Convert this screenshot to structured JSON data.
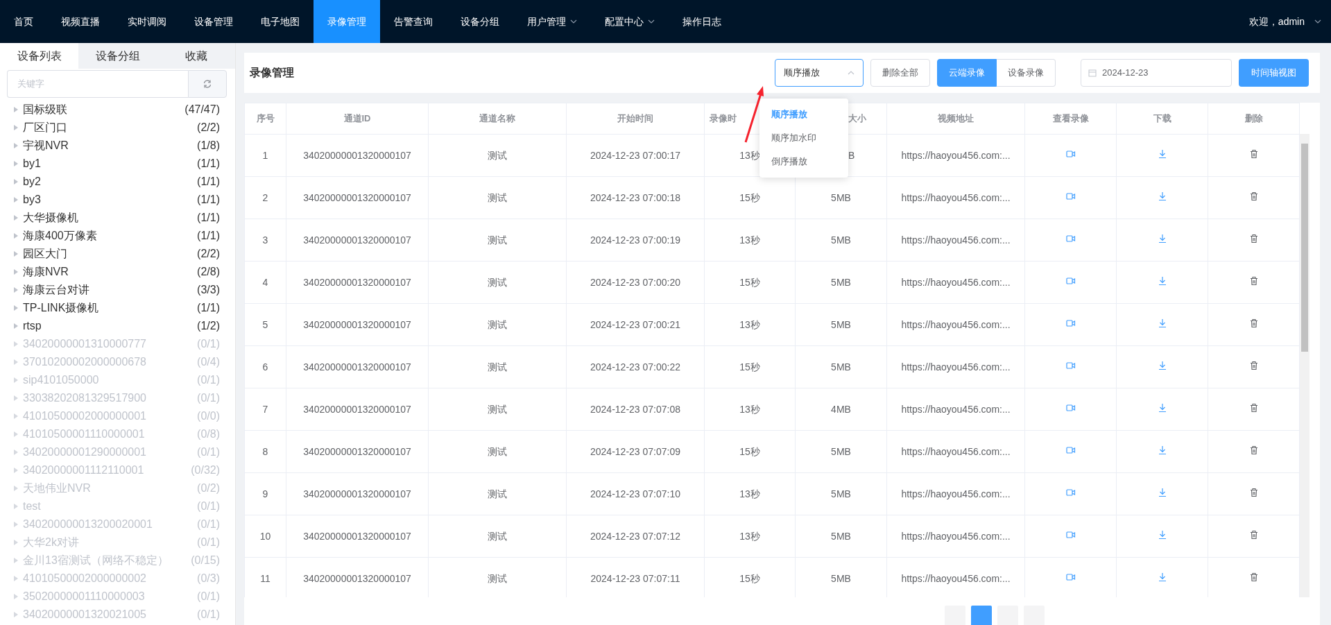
{
  "nav": {
    "items": [
      {
        "label": "首页",
        "selected": false,
        "has_menu": false
      },
      {
        "label": "视频直播",
        "selected": false,
        "has_menu": false
      },
      {
        "label": "实时调阅",
        "selected": false,
        "has_menu": false
      },
      {
        "label": "设备管理",
        "selected": false,
        "has_menu": false
      },
      {
        "label": "电子地图",
        "selected": false,
        "has_menu": false
      },
      {
        "label": "录像管理",
        "selected": true,
        "has_menu": false
      },
      {
        "label": "告警查询",
        "selected": false,
        "has_menu": false
      },
      {
        "label": "设备分组",
        "selected": false,
        "has_menu": false
      },
      {
        "label": "用户管理",
        "selected": false,
        "has_menu": true
      },
      {
        "label": "配置中心",
        "selected": false,
        "has_menu": true
      },
      {
        "label": "操作日志",
        "selected": false,
        "has_menu": false
      }
    ],
    "user": "欢迎，admin"
  },
  "sidebar": {
    "tabs": [
      {
        "label": "设备列表",
        "selected": true
      },
      {
        "label": "设备分组",
        "selected": false
      },
      {
        "label": "收藏",
        "selected": false
      }
    ],
    "search": {
      "placeholder": "关键字"
    },
    "devices": [
      {
        "name": "国标级联",
        "count": "(47/47)",
        "online": true
      },
      {
        "name": "厂区门口",
        "count": "(2/2)",
        "online": true
      },
      {
        "name": "宇视NVR",
        "count": "(1/8)",
        "online": true
      },
      {
        "name": "by1",
        "count": "(1/1)",
        "online": true
      },
      {
        "name": "by2",
        "count": "(1/1)",
        "online": true
      },
      {
        "name": "by3",
        "count": "(1/1)",
        "online": true
      },
      {
        "name": "大华摄像机",
        "count": "(1/1)",
        "online": true
      },
      {
        "name": "海康400万像素",
        "count": "(1/1)",
        "online": true
      },
      {
        "name": "园区大门",
        "count": "(2/2)",
        "online": true
      },
      {
        "name": "海康NVR",
        "count": "(2/8)",
        "online": true
      },
      {
        "name": "海康云台对讲",
        "count": "(3/3)",
        "online": true
      },
      {
        "name": "TP-LINK摄像机",
        "count": "(1/1)",
        "online": true
      },
      {
        "name": "rtsp",
        "count": "(1/2)",
        "online": true
      },
      {
        "name": "34020000001310000777",
        "count": "(0/1)",
        "online": false
      },
      {
        "name": "37010200002000000678",
        "count": "(0/4)",
        "online": false
      },
      {
        "name": "sip4101050000",
        "count": "(0/1)",
        "online": false
      },
      {
        "name": "33038202081329517900",
        "count": "(0/1)",
        "online": false
      },
      {
        "name": "41010500002000000001",
        "count": "(0/0)",
        "online": false
      },
      {
        "name": "41010500001110000001",
        "count": "(0/8)",
        "online": false
      },
      {
        "name": "34020000001290000001",
        "count": "(0/1)",
        "online": false
      },
      {
        "name": "34020000001112110001",
        "count": "(0/32)",
        "online": false
      },
      {
        "name": "天地伟业NVR",
        "count": "(0/2)",
        "online": false
      },
      {
        "name": "test",
        "count": "(0/1)",
        "online": false
      },
      {
        "name": "340200000013200020001",
        "count": "(0/1)",
        "online": false
      },
      {
        "name": "大华2k对讲",
        "count": "(0/1)",
        "online": false
      },
      {
        "name": "金川13宿测试（网络不稳定）",
        "count": "(0/15)",
        "online": false
      },
      {
        "name": "41010500002000000002",
        "count": "(0/3)",
        "online": false
      },
      {
        "name": "35020000001110000003",
        "count": "(0/1)",
        "online": false
      },
      {
        "name": "34020000001320021005",
        "count": "(0/1)",
        "online": false
      }
    ]
  },
  "header": {
    "title": "录像管理",
    "sort_select": {
      "value": "顺序播放",
      "open": true,
      "options": [
        {
          "label": "顺序播放",
          "selected": true
        },
        {
          "label": "顺序加水印",
          "selected": false
        },
        {
          "label": "倒序播放",
          "selected": false
        }
      ]
    },
    "delete_all": "删除全部",
    "source_tabs": [
      {
        "label": "云端录像",
        "selected": true
      },
      {
        "label": "设备录像",
        "selected": false
      }
    ],
    "date": "2024-12-23",
    "timeline_button": "时间轴视图"
  },
  "table": {
    "columns": [
      "序号",
      "通道ID",
      "通道名称",
      "开始时间",
      "录像时",
      "大小",
      "视频地址",
      "查看录像",
      "下载",
      "删除"
    ],
    "rows": [
      [
        "1",
        "34020000001320000107",
        "测试",
        "2024-12-23 07:00:17",
        "13秒",
        "B",
        "https://haoyou456.com:..."
      ],
      [
        "2",
        "34020000001320000107",
        "测试",
        "2024-12-23 07:00:18",
        "15秒",
        "5MB",
        "https://haoyou456.com:..."
      ],
      [
        "3",
        "34020000001320000107",
        "测试",
        "2024-12-23 07:00:19",
        "13秒",
        "5MB",
        "https://haoyou456.com:..."
      ],
      [
        "4",
        "34020000001320000107",
        "测试",
        "2024-12-23 07:00:20",
        "15秒",
        "5MB",
        "https://haoyou456.com:..."
      ],
      [
        "5",
        "34020000001320000107",
        "测试",
        "2024-12-23 07:00:21",
        "13秒",
        "5MB",
        "https://haoyou456.com:..."
      ],
      [
        "6",
        "34020000001320000107",
        "测试",
        "2024-12-23 07:00:22",
        "15秒",
        "5MB",
        "https://haoyou456.com:..."
      ],
      [
        "7",
        "34020000001320000107",
        "测试",
        "2024-12-23 07:07:08",
        "13秒",
        "4MB",
        "https://haoyou456.com:..."
      ],
      [
        "8",
        "34020000001320000107",
        "测试",
        "2024-12-23 07:07:09",
        "15秒",
        "5MB",
        "https://haoyou456.com:..."
      ],
      [
        "9",
        "34020000001320000107",
        "测试",
        "2024-12-23 07:07:10",
        "13秒",
        "5MB",
        "https://haoyou456.com:..."
      ],
      [
        "10",
        "34020000001320000107",
        "测试",
        "2024-12-23 07:07:12",
        "13秒",
        "5MB",
        "https://haoyou456.com:..."
      ],
      [
        "11",
        "34020000001320000107",
        "测试",
        "2024-12-23 07:07:11",
        "15秒",
        "5MB",
        "https://haoyou456.com:..."
      ]
    ]
  },
  "pagination": [
    {
      "selected": false
    },
    {
      "selected": true
    },
    {
      "selected": false
    },
    {
      "selected": false
    }
  ]
}
